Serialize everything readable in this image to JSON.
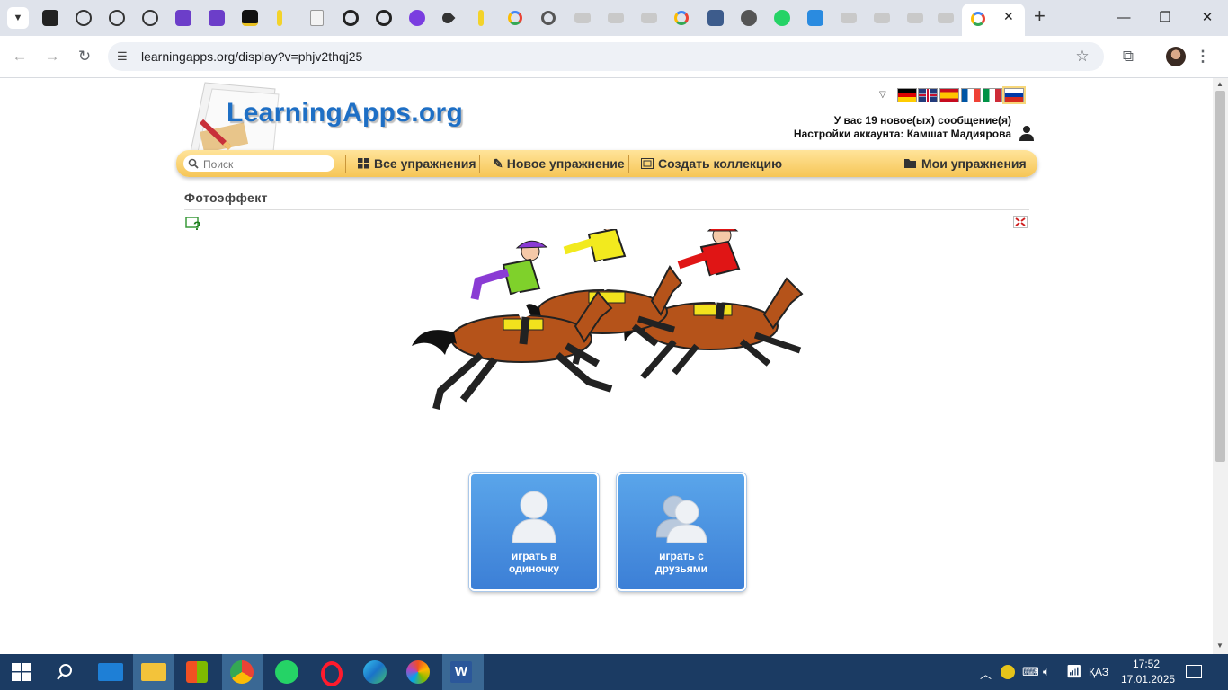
{
  "browser": {
    "url": "learningapps.org/display?v=phjv2thqj25",
    "new_tab_label": "+",
    "window": {
      "minimize": "—",
      "restore": "❐",
      "close": "✕"
    }
  },
  "site": {
    "logo_text": "LearningApps.org",
    "languages": [
      "German",
      "English",
      "Spanish",
      "French",
      "Italian",
      "Russian"
    ],
    "messages_text": "У вас 19 новое(ых) сообщение(я)",
    "account_text": "Настройки аккаунта: Камшат Мадиярова",
    "search_placeholder": "Поиск",
    "menu": {
      "all_exercises": "Все упражнения",
      "new_exercise": "Новое упражнение",
      "create_collection": "Создать коллекцию",
      "my_exercises": "Мои упражнения"
    },
    "page_title": "Фотоэффект",
    "play_alone": "играть в одиночку",
    "play_friends": "играть с друзьями"
  },
  "taskbar": {
    "language": "ҚАЗ",
    "time": "17:52",
    "date": "17.01.2025"
  },
  "colors": {
    "tabstrip": "#dfe3eb",
    "menubar": "#f6c656",
    "logo_blue": "#1e6fc5",
    "play_button": "#3c7fd6",
    "taskbar": "#1b3b63"
  },
  "icons": [
    "tab-menu-icon",
    "back-icon",
    "forward-icon",
    "reload-icon",
    "site-info-icon",
    "star-icon",
    "extensions-icon",
    "profile-avatar",
    "help-icon",
    "fullscreen-icon",
    "single-user-icon",
    "group-users-icon",
    "windows-start-icon",
    "search-icon"
  ]
}
